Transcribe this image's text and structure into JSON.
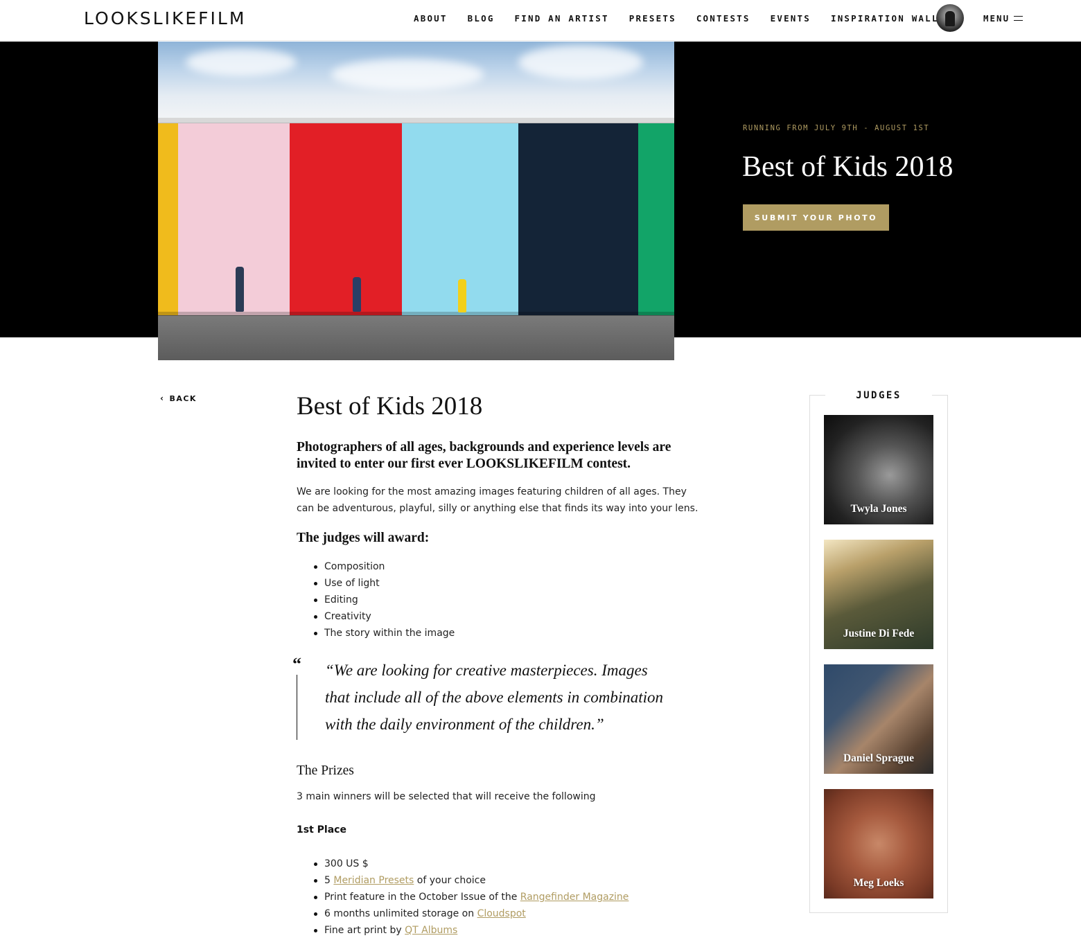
{
  "header": {
    "logo": "LOOKSLIKEFILM",
    "nav": [
      "ABOUT",
      "BLOG",
      "FIND AN ARTIST",
      "PRESETS",
      "CONTESTS",
      "EVENTS",
      "INSPIRATION WALL"
    ],
    "menu_label": "MENU"
  },
  "hero": {
    "dates": "RUNNING FROM JULY 9TH - AUGUST 1ST",
    "title": "Best of Kids 2018",
    "submit_label": "SUBMIT YOUR PHOTO"
  },
  "back_label": "BACK",
  "content": {
    "title": "Best of Kids 2018",
    "lead": "Photographers of all ages, backgrounds and experience levels are invited to enter our first ever LOOKSLIKEFILM contest.",
    "body": "We are looking for the most amazing images featuring children of all ages. They can be adventurous, playful, silly or anything else that finds its way into your lens.",
    "judges_award_heading": "The judges will award:",
    "criteria": [
      "Composition",
      "Use of light",
      "Editing",
      "Creativity",
      "The story within the image"
    ],
    "quote": "“We are looking for creative masterpieces. Images that include all of the above elements in combination with the daily environment of the children.”",
    "prizes_heading": "The Prizes",
    "prizes_text": "3 main winners will be selected that will receive the following",
    "first_place_heading": "1st Place",
    "first_place": {
      "item1": "300 US $",
      "item2_pre": "5 ",
      "item2_link": "Meridian Presets",
      "item2_post": " of your choice",
      "item3_pre": "Print feature in the October Issue of the ",
      "item3_link": "Rangefinder Magazine",
      "item4_pre": "6 months unlimited storage on ",
      "item4_link": "Cloudspot",
      "item5_pre": "Fine art print by ",
      "item5_link": "QT Albums"
    }
  },
  "judges": {
    "title": "JUDGES",
    "list": [
      "Twyla Jones",
      "Justine Di Fede",
      "Daniel Sprague",
      "Meg Loeks"
    ]
  },
  "colors": {
    "accent": "#b09c62",
    "hero_bg": "#000000"
  }
}
